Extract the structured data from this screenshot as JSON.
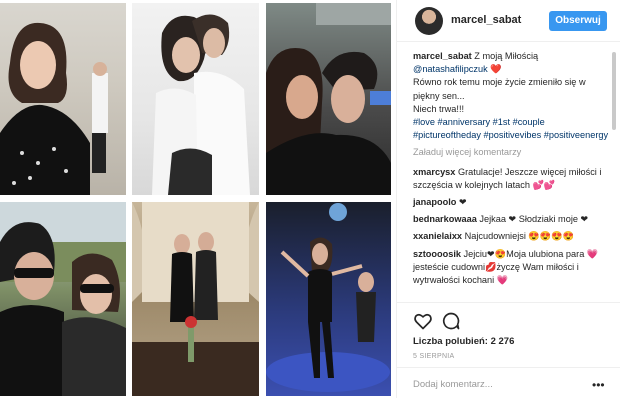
{
  "header": {
    "username": "marcel_sabat",
    "follow_label": "Obserwuj"
  },
  "caption": {
    "username": "marcel_sabat",
    "line1": " Z moją Miłością ",
    "mention": "@natashafilipczuk",
    "heart": " ❤️",
    "body": "Równo rok temu moje życie zmieniło się w piękny sen...",
    "line3": "Niech trwa!!!",
    "hashtags": "#love #anniversary #1st #couple #pictureoftheday #positivevibes #positiveenergy"
  },
  "load_more": "Załaduj więcej komentarzy",
  "comments": [
    {
      "user": "xmarcysx",
      "text": " Gratulacje! Jeszcze więcej miłości i szczęścia w kolejnych latach 💕💕"
    },
    {
      "user": "janapoolo",
      "text": " ❤"
    },
    {
      "user": "bednarkowaaa",
      "text": " Jejkaa ❤ Słodziaki moje ❤"
    },
    {
      "user": "xxanielaixx",
      "text": " Najcudowniejsi 😍😍😍😍"
    },
    {
      "user": "sztoooosik",
      "text": " Jejciu❤😍Moja ulubiona para 💗jesteście cudowni💋życzę Wam miłości i wytrwałości kochani 💗"
    }
  ],
  "likes": "Liczba polubień: 2 276",
  "date": "5 SIERPNIA",
  "add_comment_placeholder": "Dodaj komentarz...",
  "more_options": "•••",
  "icons": {
    "like": "heart-outline-icon",
    "comment": "speech-bubble-icon"
  },
  "colors": {
    "follow": "#3897f0",
    "hashtag": "#003569",
    "muted": "#999999"
  }
}
